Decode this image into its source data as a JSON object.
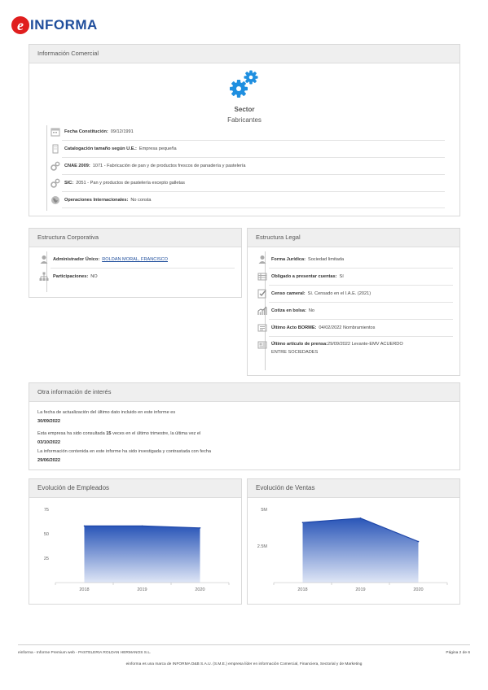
{
  "logo": {
    "e": "e",
    "text": "INFORMA"
  },
  "info_comercial": {
    "title": "Información Comercial",
    "sector_label": "Sector",
    "sector_value": "Fabricantes",
    "rows": [
      {
        "label": "Fecha Constitución:",
        "value": "09/12/1991"
      },
      {
        "label": "Catalogación tamaño según U.E.:",
        "value": "Empresa pequeña"
      },
      {
        "label": "CNAE 2009:",
        "value": "1071 - Fabricación de pan y de productos frescos de panadería y pastelería"
      },
      {
        "label": "SIC:",
        "value": "2051 - Pan y productos de pastelería excepto galletas"
      },
      {
        "label": "Operaciones Internacionales:",
        "value": "No consta"
      }
    ]
  },
  "estructura_corporativa": {
    "title": "Estructura Corporativa",
    "rows": [
      {
        "label": "Administrador Único:",
        "value": "ROLDAN MORAL, FRANCISCO"
      },
      {
        "label": "Participaciones:",
        "value": "NO"
      }
    ]
  },
  "estructura_legal": {
    "title": "Estructura Legal",
    "rows": [
      {
        "label": "Forma Jurídica:",
        "value": "Sociedad limitada"
      },
      {
        "label": "Obligado a presentar cuentas:",
        "value": "Sí"
      },
      {
        "label": "Censo cameral:",
        "value": "Sí. Censado en el I.A.E. (2021)"
      },
      {
        "label": "Cotiza en bolsa:",
        "value": "No"
      },
      {
        "label": "Último Acto BORME:",
        "value": "04/02/2022  Nombramientos"
      },
      {
        "label": "Último artículo de prensa:",
        "value": "29/09/2022 Levante-EMV ACUERDO",
        "value2": "ENTRE SOCIEDADES"
      }
    ]
  },
  "otra_info": {
    "title": "Otra información de interés",
    "line1": "La fecha de actualización del último dato incluido en este informe es",
    "date1": "30/09/2022",
    "line2a": "Esta empresa ha sido consultada",
    "count": "15",
    "line2b": "veces en el último trimestre, la última vez el",
    "date2": "03/10/2022",
    "line3": "La información contenida en este informe ha sido investigada y contrastada con fecha",
    "date3": "29/06/2022"
  },
  "chart_data": [
    {
      "type": "area",
      "title": "Evolución de Empleados",
      "categories": [
        "2018",
        "2019",
        "2020"
      ],
      "yticks": [
        "75",
        "50",
        "25"
      ],
      "ylim": [
        0,
        75
      ],
      "grid": false,
      "series": [
        {
          "values": [
            58,
            58,
            56
          ]
        }
      ]
    },
    {
      "type": "area",
      "title": "Evolución de Ventas",
      "categories": [
        "2018",
        "2019",
        "2020"
      ],
      "yticks": [
        "5M",
        "2.5M"
      ],
      "ylim": [
        0,
        5000000
      ],
      "grid": false,
      "series": [
        {
          "values": [
            4100000,
            4400000,
            2800000
          ]
        }
      ]
    }
  ],
  "footer": {
    "left": "einforma - Informe Premium web - PASTELERIA ROLDAN HERMANOS S.L.",
    "right": "Página 2 de 6",
    "bottom": "einforma es una marca de INFORMA D&B S.A.U. (S.M.E.) empresa líder en información Comercial, Financiera, Sectorial y de Marketing"
  },
  "colors": {
    "brand_red": "#e01e1e",
    "brand_blue": "#1f4e9c",
    "gear_blue": "#1f8fe0",
    "chart_top": "#2a56b8",
    "chart_bottom": "#dfe6f6"
  }
}
